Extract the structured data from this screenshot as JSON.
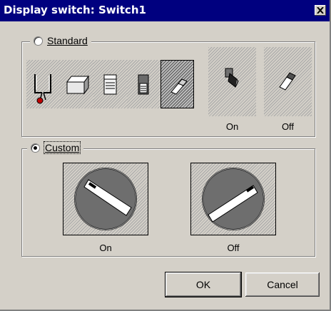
{
  "window": {
    "title": "Display switch: Switch1"
  },
  "standard": {
    "label": "Standard",
    "selected": false,
    "styles": [
      {
        "icon": "toggle-lever-icon",
        "selected": false
      },
      {
        "icon": "flat-switch-icon",
        "selected": false
      },
      {
        "icon": "rocker-switch-icon",
        "selected": false
      },
      {
        "icon": "slide-switch-icon",
        "selected": false
      },
      {
        "icon": "paddle-switch-icon",
        "selected": true
      }
    ],
    "on_label": "On",
    "off_label": "Off"
  },
  "custom": {
    "label": "Custom",
    "selected": true,
    "on_label": "On",
    "off_label": "Off"
  },
  "buttons": {
    "ok": "OK",
    "cancel": "Cancel"
  }
}
